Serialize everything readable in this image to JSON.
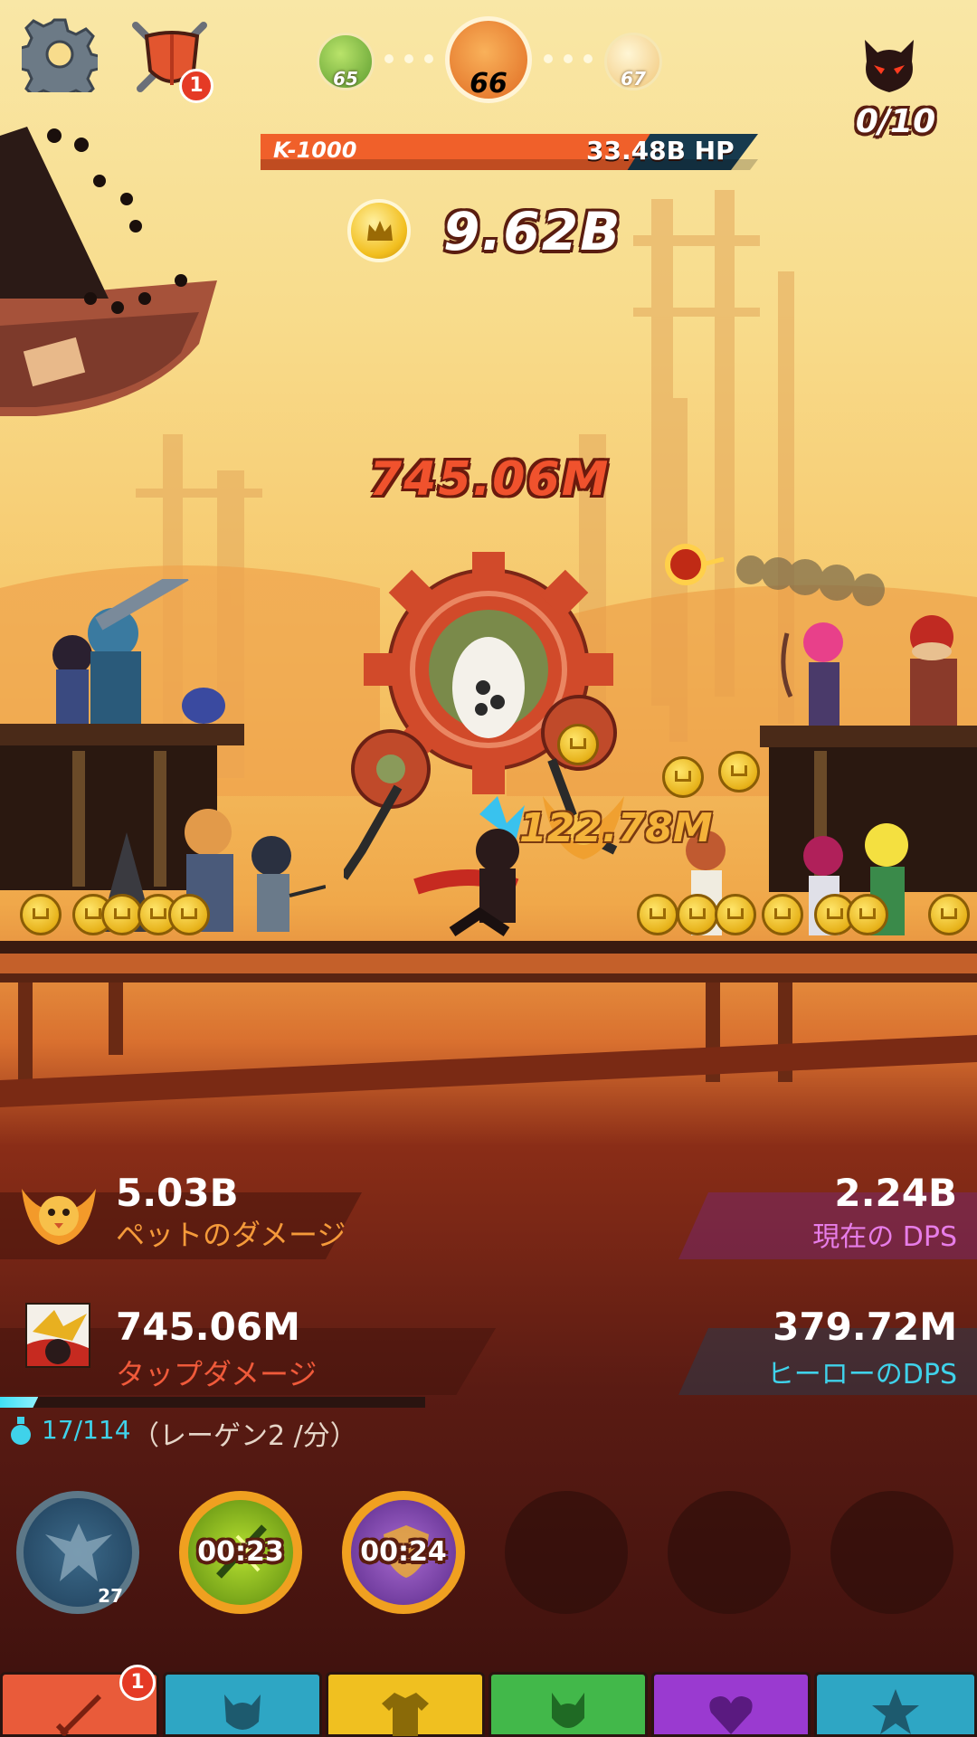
{
  "stage": {
    "prev": "65",
    "current": "66",
    "next": "67"
  },
  "shield_badge": "1",
  "enemy_counter": "0/10",
  "boss": {
    "name": "K-1000",
    "hp": "33.48B HP",
    "hp_fraction": 0.78
  },
  "gold": "9.62B",
  "damage_popups": {
    "main": "745.06M",
    "secondary": "122.78M"
  },
  "stats": {
    "pet_damage_value": "5.03B",
    "pet_damage_label": "ペットのダメージ",
    "current_dps_value": "2.24B",
    "current_dps_label": "現在の DPS",
    "tap_damage_value": "745.06M",
    "tap_damage_label": "タップダメージ",
    "hero_dps_value": "379.72M",
    "hero_dps_label": "ヒーローのDPS"
  },
  "mana": {
    "value": "17/114",
    "regen": "（レーゲン2 /分）",
    "fraction": 0.15
  },
  "skills": [
    {
      "name": "phoenix-skill",
      "level": "27"
    },
    {
      "name": "lightning-skill",
      "timer": "00:23"
    },
    {
      "name": "shield-skill",
      "timer": "00:24"
    }
  ],
  "tabs_badge": "1",
  "colors": {
    "hp_bar": "#f0602a",
    "pet_label": "#f59a3a",
    "dps_label": "#e77de8",
    "tap_label": "#f05a3a",
    "hero_label": "#3fd2ea"
  }
}
